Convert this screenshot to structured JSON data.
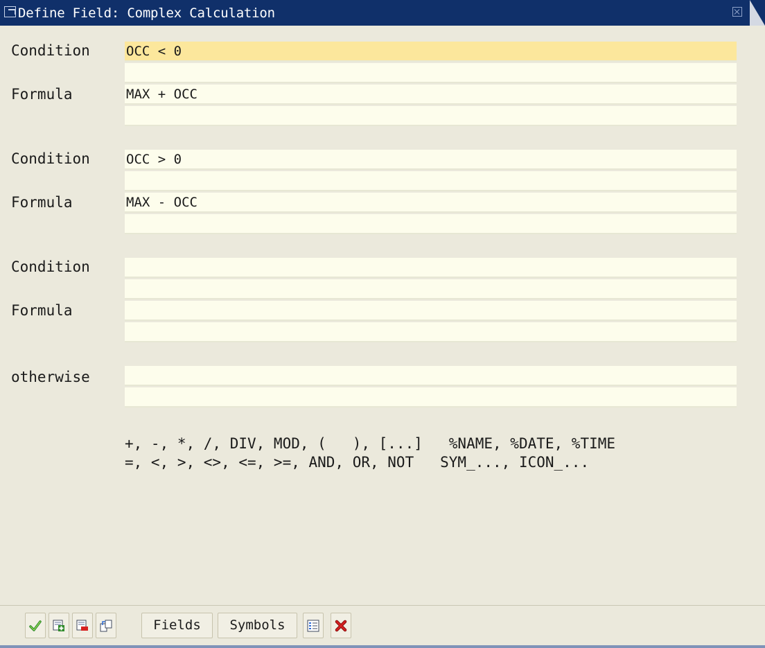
{
  "window": {
    "title": "Define Field: Complex Calculation"
  },
  "rows": [
    {
      "label": "Condition",
      "value": "OCC < 0"
    },
    {
      "label": "Formula",
      "value": "MAX + OCC"
    },
    {
      "label": "Condition",
      "value": "OCC > 0"
    },
    {
      "label": "Formula",
      "value": "MAX - OCC"
    },
    {
      "label": "Condition",
      "value": ""
    },
    {
      "label": "Formula",
      "value": ""
    },
    {
      "label": "otherwise",
      "value": ""
    }
  ],
  "help": {
    "line1": "+, -, *, /, DIV, MOD, (   ), [...]   %NAME, %DATE, %TIME",
    "line2": "=, <, >, <>, <=, >=, AND, OR, NOT   SYM_..., ICON_..."
  },
  "toolbar": {
    "fields_label": "Fields",
    "symbols_label": "Symbols",
    "icons": [
      "checkmark-icon",
      "insert-line-icon",
      "delete-line-icon",
      "copy-icon",
      "list-icon",
      "cancel-icon"
    ]
  },
  "colors": {
    "title_bar": "#10306a",
    "focused_input": "#fce79c",
    "input_bg": "#fdfdec",
    "check_green": "#2f8a2a",
    "cancel_red": "#d62020"
  }
}
